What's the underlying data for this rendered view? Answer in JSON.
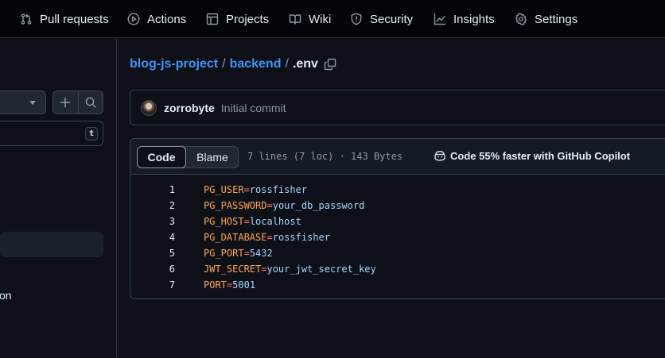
{
  "nav": {
    "pull_requests": "Pull requests",
    "actions": "Actions",
    "projects": "Projects",
    "wiki": "Wiki",
    "security": "Security",
    "insights": "Insights",
    "settings": "Settings"
  },
  "sidebar": {
    "shortcut_key": "t",
    "partial_item": "on"
  },
  "breadcrumb": {
    "repo": "blog-js-project",
    "folder": "backend",
    "file": ".env",
    "sep1": "/",
    "sep2": "/"
  },
  "commit": {
    "author": "zorrobyte",
    "message": "Initial commit"
  },
  "file": {
    "tab_code": "Code",
    "tab_blame": "Blame",
    "meta": "7 lines (7 loc) · 143 Bytes",
    "copilot": "Code 55% faster with GitHub Copilot",
    "lines": [
      {
        "num": "1",
        "key": "PG_USER",
        "eq": "=",
        "value": "rossfisher"
      },
      {
        "num": "2",
        "key": "PG_PASSWORD",
        "eq": "=",
        "value": "your_db_password"
      },
      {
        "num": "3",
        "key": "PG_HOST",
        "eq": "=",
        "value": "localhost"
      },
      {
        "num": "4",
        "key": "PG_DATABASE",
        "eq": "=",
        "value": "rossfisher"
      },
      {
        "num": "5",
        "key": "PG_PORT",
        "eq": "=",
        "value": "5432"
      },
      {
        "num": "6",
        "key": "JWT_SECRET",
        "eq": "=",
        "value": "your_jwt_secret_key"
      },
      {
        "num": "7",
        "key": "PORT",
        "eq": "=",
        "value": "5001"
      }
    ]
  },
  "colors": {
    "background": "#0d1117",
    "link": "#4493f8",
    "env_key": "#ffa657",
    "env_value": "#a5d6ff"
  }
}
